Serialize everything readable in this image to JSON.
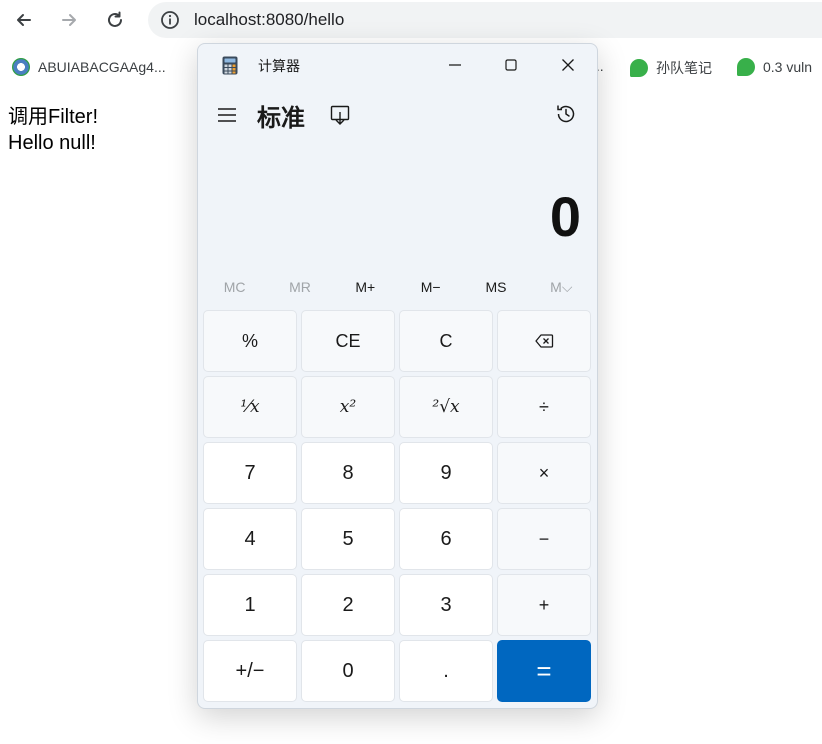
{
  "browser": {
    "url": "localhost:8080/hello",
    "bookmarks": [
      {
        "label": "ABUIABACGAAg4...",
        "color": "#4a7fc1"
      },
      {
        "label": "...",
        "color": ""
      },
      {
        "label": "孙队笔记",
        "color": "#38b04a"
      },
      {
        "label": "0.3 vuln",
        "color": "#38b04a"
      }
    ]
  },
  "page": {
    "line1": "调用Filter!",
    "line2": "Hello null!"
  },
  "calculator": {
    "window_title": "计算器",
    "mode": "标准",
    "display_value": "0",
    "memory": [
      "MC",
      "MR",
      "M+",
      "M−",
      "MS",
      "M⌵"
    ],
    "keys": [
      "%",
      "CE",
      "C",
      "⌫",
      "¹⁄x",
      "x²",
      "²√x",
      "÷",
      "7",
      "8",
      "9",
      "×",
      "4",
      "5",
      "6",
      "−",
      "1",
      "2",
      "3",
      "+",
      "+/−",
      "0",
      ".",
      "="
    ],
    "accent_color": "#0067c0"
  }
}
